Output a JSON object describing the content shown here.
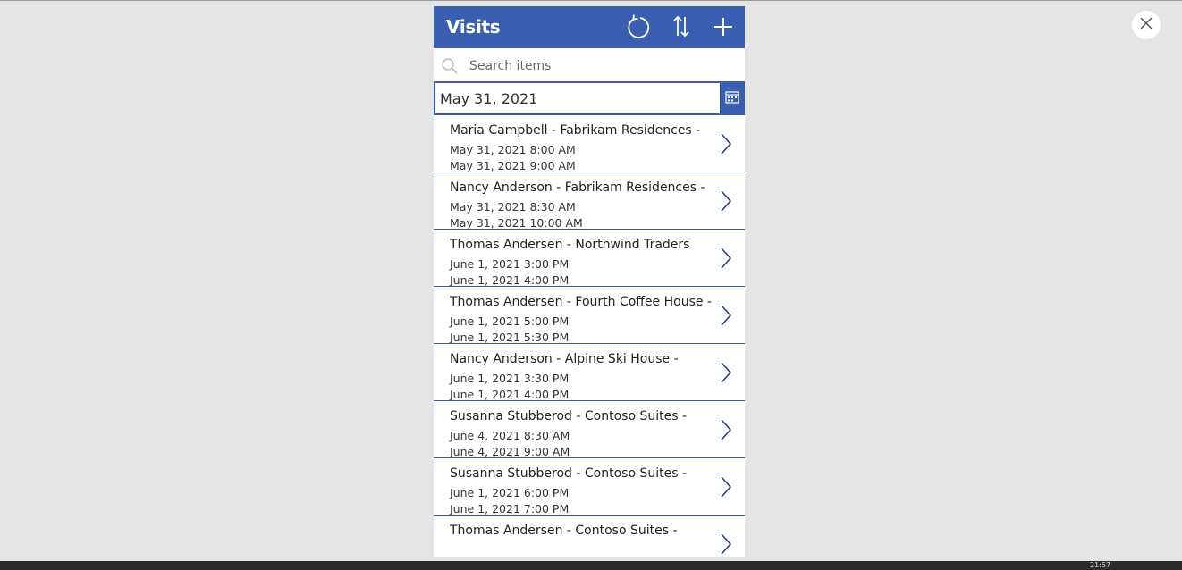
{
  "header": {
    "title": "Visits",
    "refresh_icon": "refresh-icon",
    "sort_icon": "sort-icon",
    "add_icon": "plus-icon"
  },
  "search": {
    "placeholder": "Search items",
    "value": ""
  },
  "date_picker": {
    "value": "May 31, 2021",
    "icon": "calendar-icon"
  },
  "visits": [
    {
      "title": "Maria Campbell - Fabrikam Residences -",
      "start": "May 31, 2021 8:00 AM",
      "end": "May 31, 2021 9:00 AM"
    },
    {
      "title": "Nancy Anderson - Fabrikam Residences -",
      "start": "May 31, 2021 8:30 AM",
      "end": "May 31, 2021 10:00 AM"
    },
    {
      "title": "Thomas Andersen - Northwind Traders",
      "start": "June 1, 2021 3:00 PM",
      "end": "June 1, 2021 4:00 PM"
    },
    {
      "title": "Thomas Andersen - Fourth Coffee House -",
      "start": "June 1, 2021 5:00 PM",
      "end": "June 1, 2021 5:30 PM"
    },
    {
      "title": "Nancy Anderson - Alpine Ski House -",
      "start": "June 1, 2021 3:30 PM",
      "end": "June 1, 2021 4:00 PM"
    },
    {
      "title": "Susanna Stubberod - Contoso Suites -",
      "start": "June 4, 2021 8:30 AM",
      "end": "June 4, 2021 9:00 AM"
    },
    {
      "title": "Susanna Stubberod - Contoso Suites -",
      "start": "June 1, 2021 6:00 PM",
      "end": "June 1, 2021 7:00 PM"
    },
    {
      "title": "Thomas Andersen - Contoso Suites -",
      "start": "",
      "end": ""
    }
  ],
  "taskbar": {
    "clock": "21:57"
  },
  "colors": {
    "accent": "#3a5fb0",
    "background": "#e5e5e5",
    "chevron": "#2c3e8c"
  }
}
